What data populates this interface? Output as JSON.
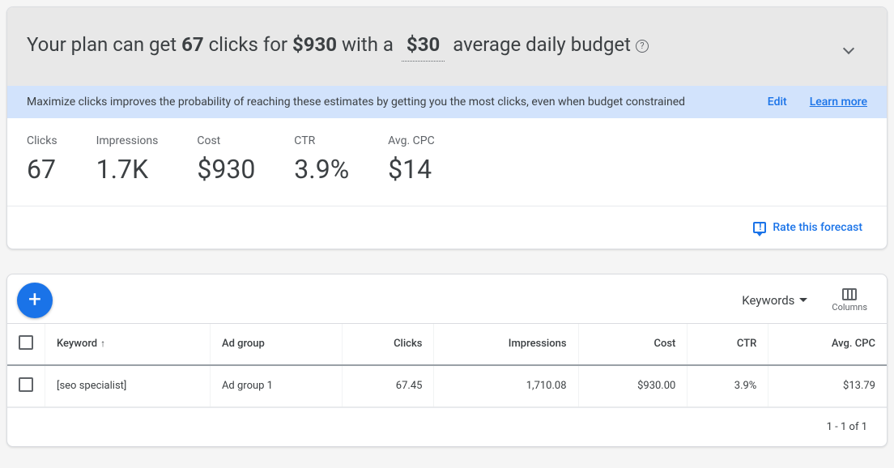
{
  "plan_header": {
    "prefix": "Your plan can get ",
    "clicks": "67",
    "mid1": " clicks for ",
    "cost": "$930",
    "mid2": " with a ",
    "budget": "$30",
    "suffix": " average daily budget"
  },
  "info_bar": {
    "text": "Maximize clicks improves the probability of reaching these estimates by getting you the most clicks, even when budget constrained",
    "edit": "Edit",
    "learn_more": "Learn more"
  },
  "stats": {
    "clicks_label": "Clicks",
    "clicks_value": "67",
    "impressions_label": "Impressions",
    "impressions_value": "1.7K",
    "cost_label": "Cost",
    "cost_value": "$930",
    "ctr_label": "CTR",
    "ctr_value": "3.9%",
    "avgcpc_label": "Avg. CPC",
    "avgcpc_value": "$14"
  },
  "rate_label": "Rate this forecast",
  "table_toolbar": {
    "keywords_label": "Keywords",
    "columns_label": "Columns"
  },
  "table": {
    "headers": {
      "keyword": "Keyword",
      "sort_arrow": "↑",
      "adgroup": "Ad group",
      "clicks": "Clicks",
      "impressions": "Impressions",
      "cost": "Cost",
      "ctr": "CTR",
      "avgcpc": "Avg. CPC"
    },
    "rows": [
      {
        "keyword": "[seo specialist]",
        "adgroup": "Ad group 1",
        "clicks": "67.45",
        "impressions": "1,710.08",
        "cost": "$930.00",
        "ctr": "3.9%",
        "avgcpc": "$13.79"
      }
    ],
    "footer": "1 - 1 of 1"
  }
}
